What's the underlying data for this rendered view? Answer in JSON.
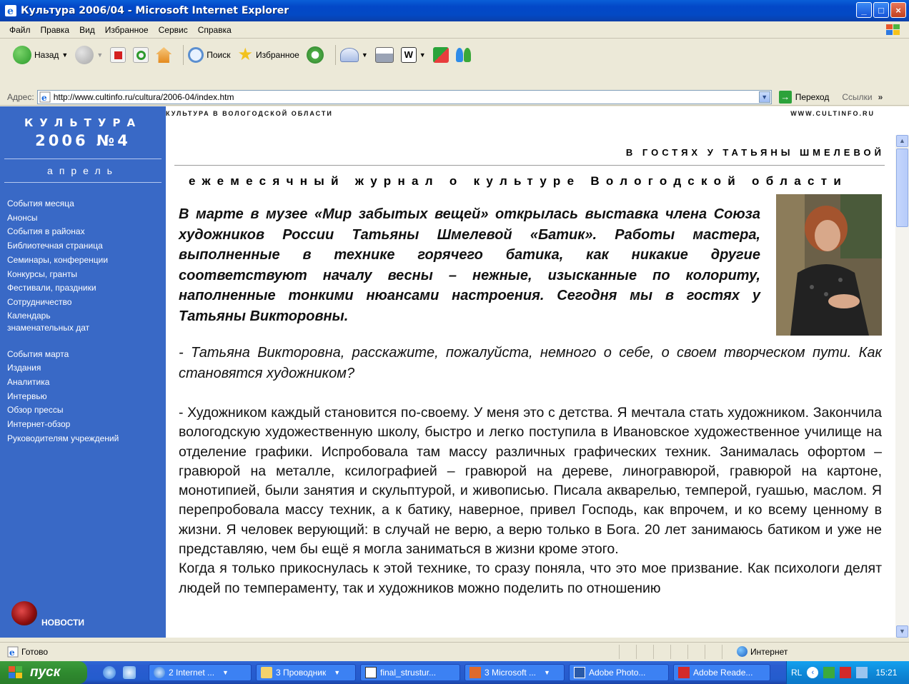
{
  "window": {
    "title": "Культура 2006/04 - Microsoft Internet Explorer",
    "controls": [
      "_",
      "□",
      "×"
    ]
  },
  "menu": [
    "Файл",
    "Правка",
    "Вид",
    "Избранное",
    "Сервис",
    "Справка"
  ],
  "toolbar": {
    "back_label": "Назад",
    "search_label": "Поиск",
    "favorites_label": "Избранное"
  },
  "address": {
    "label": "Адрес:",
    "url": "http://www.cultinfo.ru/cultura/2006-04/index.htm",
    "go_label": "Переход",
    "links_label": "Ссылки",
    "chevron": "»"
  },
  "sidebar": {
    "title": "КУЛЬТУРА",
    "issue": "2006 №4",
    "month": "апрель",
    "nav_group1": [
      "События месяца",
      "Анонсы",
      "События в районах",
      "Библиотечная страница",
      "Семинары, конференции",
      "Конкурсы, гранты",
      "Фестивали, праздники",
      "Сотрудничество",
      "Календарь",
      "знаменательных дат"
    ],
    "nav_group2": [
      "События марта",
      "Издания",
      "Аналитика",
      "Интервью",
      "Обзор прессы",
      "Интернет-обзор",
      "Руководителям учреждений"
    ],
    "news_label": "НОВОСТИ"
  },
  "page": {
    "top_left": "КУЛЬТУРА В ВОЛОГОДСКОЙ ОБЛАСТИ",
    "top_right": "WWW.CULTINFO.RU",
    "section_title": "В ГОСТЯХ У ТАТЬЯНЫ ШМЕЛЕВОЙ",
    "subtitle": "ежемесячный журнал о культуре Вологодской области",
    "lead": "В марте в музее «Мир забытых вещей» открылась выставка члена Союза художников России Татьяны Шмелевой «Батик». Работы мастера, выполненные в технике горячего батика, как никакие другие соответствуют началу весны – нежные, изысканные по колориту, наполненные тонкими нюансами настроения. Сегодня мы в гостях у Татьяны Викторовны.",
    "question": "- Татьяна Викторовна, расскажите, пожалуйста, немного о себе, о своем творческом пути. Как становятся художником?",
    "answer_p1": "- Художником каждый становится по-своему. У меня это с детства. Я мечтала стать художником. Закончила вологодскую художественную школу, быстро и легко поступила в Ивановское художественное училище на отделение графики. Испробовала там массу различных графических техник. Занималась офортом – гравюрой на металле, ксилографией – гравюрой на дереве, линогравюрой, гравюрой на картоне, монотипией, были занятия и скульптурой, и живописью. Писала акварелью, темперой, гуашью, маслом. Я перепробовала массу техник, а к батику, наверное, привел Господь, как впрочем, и ко всему ценному в жизни. Я человек верующий: в случай не верю, а верю только в Бога. 20 лет занимаюсь батиком и уже не представляю, чем бы ещё я могла заниматься в жизни кроме этого.",
    "answer_p2": "Когда я только прикоснулась к этой технике, то сразу поняла, что это мое призвание. Как психологи делят людей по темпераменту, так и художников можно поделить по отношению"
  },
  "status": {
    "left": "Готово",
    "zone": "Интернет"
  },
  "taskbar": {
    "start": "пуск",
    "tasks": [
      "2 Internet ...",
      "3 Проводник",
      "final_strustur...",
      "3 Microsoft ...",
      "Adobe Photo...",
      "Adobe Reade..."
    ],
    "lang": "RL",
    "clock": "15:21"
  },
  "colors": {
    "sidebar_bg": "#3969c6",
    "title_bar": "#0348c8",
    "taskbar": "#245ccd",
    "start_button": "#2f8a2f"
  }
}
